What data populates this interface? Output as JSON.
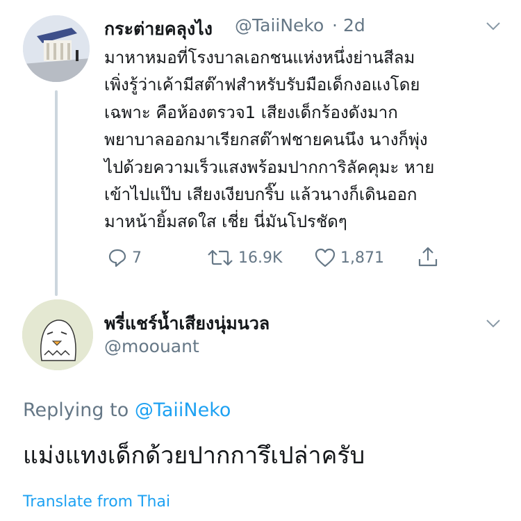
{
  "tweet": {
    "display_name": "กระต่ายคลุงไง",
    "handle": "@TaiiNeko",
    "separator": "·",
    "timestamp": "2d",
    "body_lines": [
      "มาหาหมอที่โรงบาลเอกชนแห่งหนึ่งย่านสีลม",
      "เพิ่งรู้ว่าเค้ามีสต๊าฟสำหรับรับมือเด็กงอแงโดย",
      "เฉพาะ คือห้องตรวจ1 เสียงเด็กร้องดังมาก",
      "พยาบาลออกมาเรียกสต๊าฟชายคนนึง นางก็พุ่ง",
      "ไปด้วยความเร็วแสงพร้อมปากการิลัคคุมะ หาย",
      "เข้าไปแป๊บ เสียงเงียบกริ๊บ แล้วนางก็เดินออก",
      "มาหน้ายิ้มสดใส เชี่ย นี่มันโปรชัดๆ"
    ],
    "actions": {
      "reply_count": "7",
      "retweet_count": "16.9K",
      "like_count": "1,871"
    }
  },
  "reply": {
    "display_name": "พรี่แชร์น้ำเสียงนุ่มนวล",
    "handle": "@moouant",
    "replying_prefix": "Replying to",
    "replying_to": "@TaiiNeko",
    "body": "แม่งแทงเด็กด้วยปากการึเปล่าครับ",
    "translate_label": "Translate from Thai"
  },
  "colors": {
    "text_primary": "#14171a",
    "text_secondary": "#657786",
    "link": "#1da1f2",
    "thread_line": "#ccd6dd"
  }
}
